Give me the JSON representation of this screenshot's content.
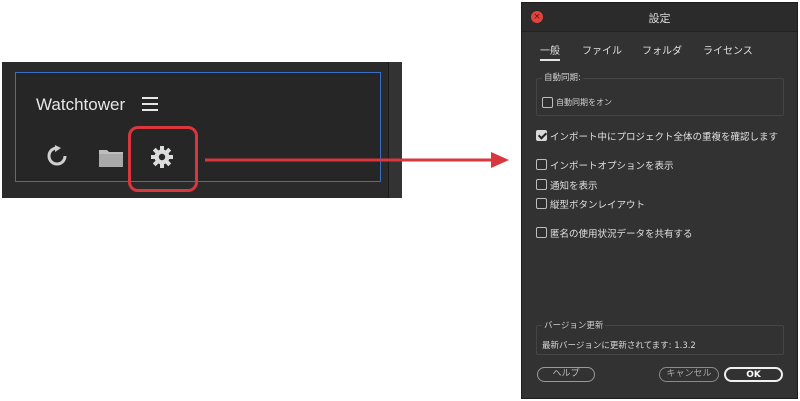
{
  "panel": {
    "title": "Watchtower",
    "icons": [
      "hamburger-menu-icon",
      "refresh-icon",
      "folder-icon",
      "gear-icon"
    ]
  },
  "colors": {
    "highlight": "#d9363e",
    "panel_border": "#3b6fc4",
    "dialog_bg": "#323232"
  },
  "dialog": {
    "title": "設定",
    "tabs": [
      "一般",
      "ファイル",
      "フォルダ",
      "ライセンス"
    ],
    "auto_sync": {
      "group_label": "自動同期:",
      "option_label": "自動同期をオン"
    },
    "options": [
      {
        "label": "インポート中にプロジェクト全体の重複を確認します",
        "checked": true
      },
      {
        "label": "インポートオプションを表示",
        "checked": false
      },
      {
        "label": "通知を表示",
        "checked": false
      },
      {
        "label": "縦型ボタンレイアウト",
        "checked": false
      },
      {
        "label": "匿名の使用状況データを共有する",
        "checked": false
      }
    ],
    "version": {
      "group_label": "バージョン更新",
      "status": "最新バージョンに更新されてます: 1.3.2"
    },
    "buttons": {
      "help": "ヘルプ",
      "cancel": "キャンセル",
      "ok": "OK"
    }
  }
}
